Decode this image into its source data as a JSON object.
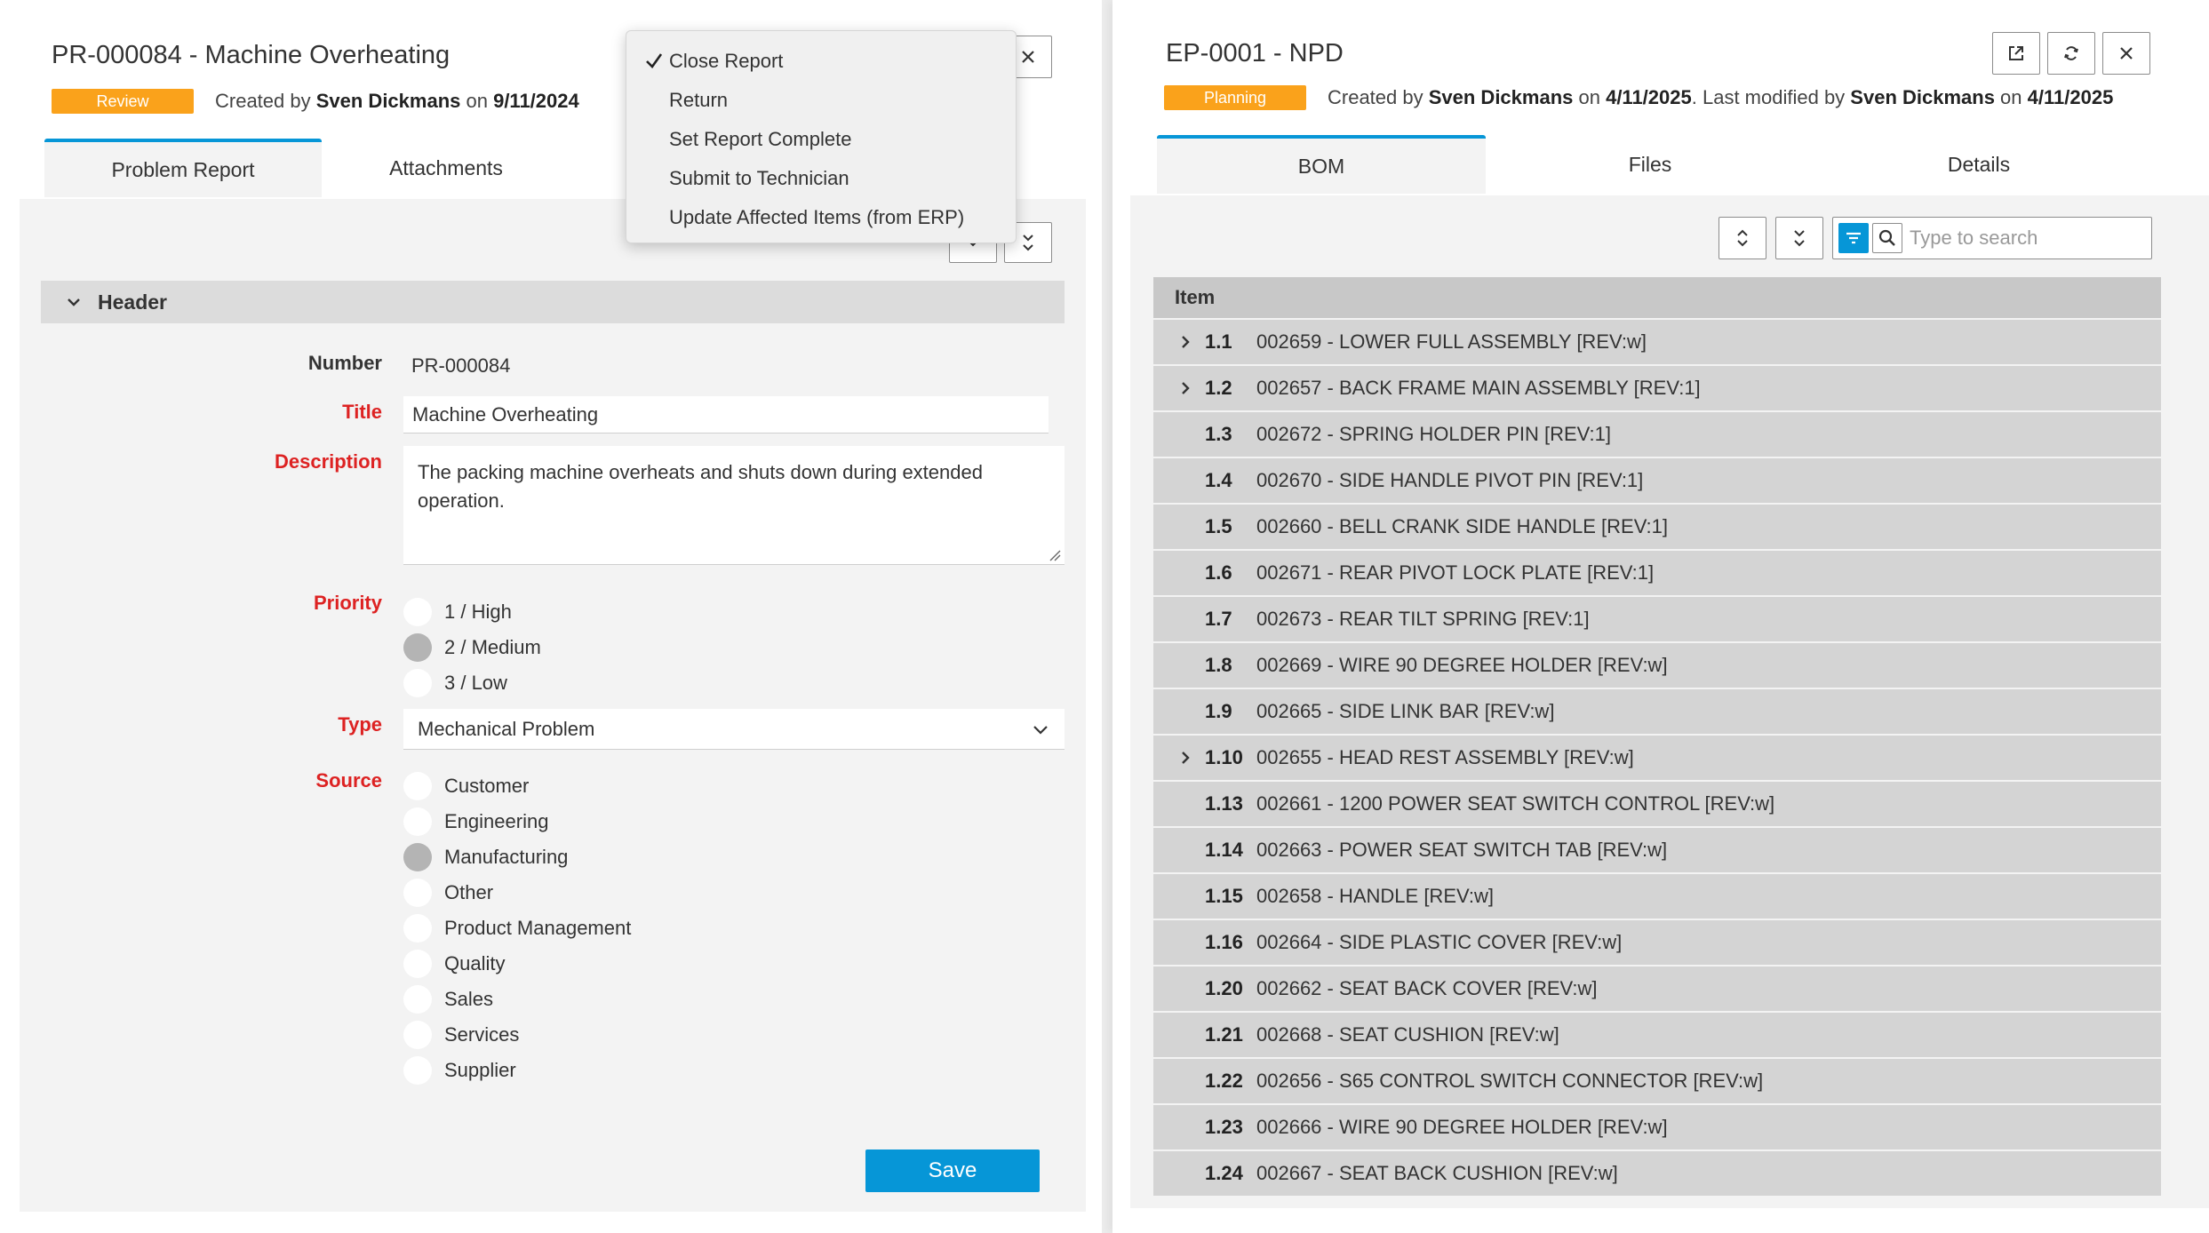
{
  "left": {
    "title": "PR-000084 - Machine Overheating",
    "status": "Review",
    "created_prefix": "Created by ",
    "created_by": "Sven Dickmans",
    "created_on_word": " on ",
    "created_date": "9/11/2024",
    "tabs": [
      {
        "label": "Problem Report",
        "active": true
      },
      {
        "label": "Attachments",
        "active": false
      }
    ],
    "section_title": "Header",
    "fields": {
      "number_label": "Number",
      "number_value": "PR-000084",
      "title_label": "Title",
      "title_value": "Machine Overheating",
      "description_label": "Description",
      "description_value": "The packing machine overheats and shuts down during extended operation.",
      "priority_label": "Priority",
      "priority_options": [
        "1 / High",
        "2 / Medium",
        "3 / Low"
      ],
      "priority_selected": "2 / Medium",
      "type_label": "Type",
      "type_value": "Mechanical Problem",
      "source_label": "Source",
      "source_options": [
        "Customer",
        "Engineering",
        "Manufacturing",
        "Other",
        "Product Management",
        "Quality",
        "Sales",
        "Services",
        "Supplier"
      ],
      "source_selected": "Manufacturing"
    },
    "save_label": "Save",
    "menu": {
      "items": [
        "Close Report",
        "Return",
        "Set Report Complete",
        "Submit to Technician",
        "Update Affected Items (from ERP)"
      ],
      "checked": "Close Report"
    }
  },
  "right": {
    "title": "EP-0001 - NPD",
    "status": "Planning",
    "created_prefix": "Created by ",
    "created_by": "Sven Dickmans",
    "created_on_word": " on ",
    "created_date": "4/11/2025",
    "modified_prefix": ". Last modified by ",
    "modified_by": "Sven Dickmans",
    "modified_on_word": " on ",
    "modified_date": "4/11/2025",
    "tabs": [
      {
        "label": "BOM",
        "active": true
      },
      {
        "label": "Files",
        "active": false
      },
      {
        "label": "Details",
        "active": false
      }
    ],
    "search_placeholder": "Type to search",
    "table_header": "Item",
    "rows": [
      {
        "num": "1.1",
        "desc": "002659 - LOWER FULL ASSEMBLY [REV:w]",
        "expandable": true
      },
      {
        "num": "1.2",
        "desc": "002657 - BACK FRAME MAIN ASSEMBLY [REV:1]",
        "expandable": true
      },
      {
        "num": "1.3",
        "desc": "002672 - SPRING HOLDER PIN [REV:1]",
        "expandable": false
      },
      {
        "num": "1.4",
        "desc": "002670 - SIDE HANDLE PIVOT PIN [REV:1]",
        "expandable": false
      },
      {
        "num": "1.5",
        "desc": "002660 - BELL CRANK SIDE HANDLE [REV:1]",
        "expandable": false
      },
      {
        "num": "1.6",
        "desc": "002671 - REAR PIVOT LOCK PLATE [REV:1]",
        "expandable": false
      },
      {
        "num": "1.7",
        "desc": "002673 - REAR TILT SPRING [REV:1]",
        "expandable": false
      },
      {
        "num": "1.8",
        "desc": "002669 - WIRE 90 DEGREE HOLDER [REV:w]",
        "expandable": false
      },
      {
        "num": "1.9",
        "desc": "002665 - SIDE LINK BAR [REV:w]",
        "expandable": false
      },
      {
        "num": "1.10",
        "desc": "002655 - HEAD REST ASSEMBLY [REV:w]",
        "expandable": true
      },
      {
        "num": "1.13",
        "desc": "002661 - 1200 POWER SEAT SWITCH CONTROL [REV:w]",
        "expandable": false
      },
      {
        "num": "1.14",
        "desc": "002663 - POWER SEAT SWITCH TAB [REV:w]",
        "expandable": false
      },
      {
        "num": "1.15",
        "desc": "002658 - HANDLE [REV:w]",
        "expandable": false
      },
      {
        "num": "1.16",
        "desc": "002664 - SIDE PLASTIC COVER [REV:w]",
        "expandable": false
      },
      {
        "num": "1.20",
        "desc": "002662 - SEAT BACK COVER [REV:w]",
        "expandable": false
      },
      {
        "num": "1.21",
        "desc": "002668 - SEAT CUSHION [REV:w]",
        "expandable": false
      },
      {
        "num": "1.22",
        "desc": "002656 - S65 CONTROL SWITCH CONNECTOR [REV:w]",
        "expandable": false
      },
      {
        "num": "1.23",
        "desc": "002666 - WIRE 90 DEGREE HOLDER [REV:w]",
        "expandable": false
      },
      {
        "num": "1.24",
        "desc": "002667 - SEAT BACK CUSHION [REV:w]",
        "expandable": false
      }
    ]
  },
  "colors": {
    "accent": "#0696d7",
    "status_badge": "#faa21b",
    "required_label": "#dd2222",
    "panel_background": "#f3f3f3"
  },
  "icons": {
    "close": "close-icon",
    "open_external": "open-external-icon",
    "refresh": "refresh-icon",
    "expand_all": "expand-all-icon",
    "collapse_all": "collapse-all-icon",
    "filter": "filter-icon",
    "search": "search-icon",
    "dropdown": "chevron-down-icon",
    "row_expander": "chevron-right-icon",
    "check": "check-icon"
  }
}
